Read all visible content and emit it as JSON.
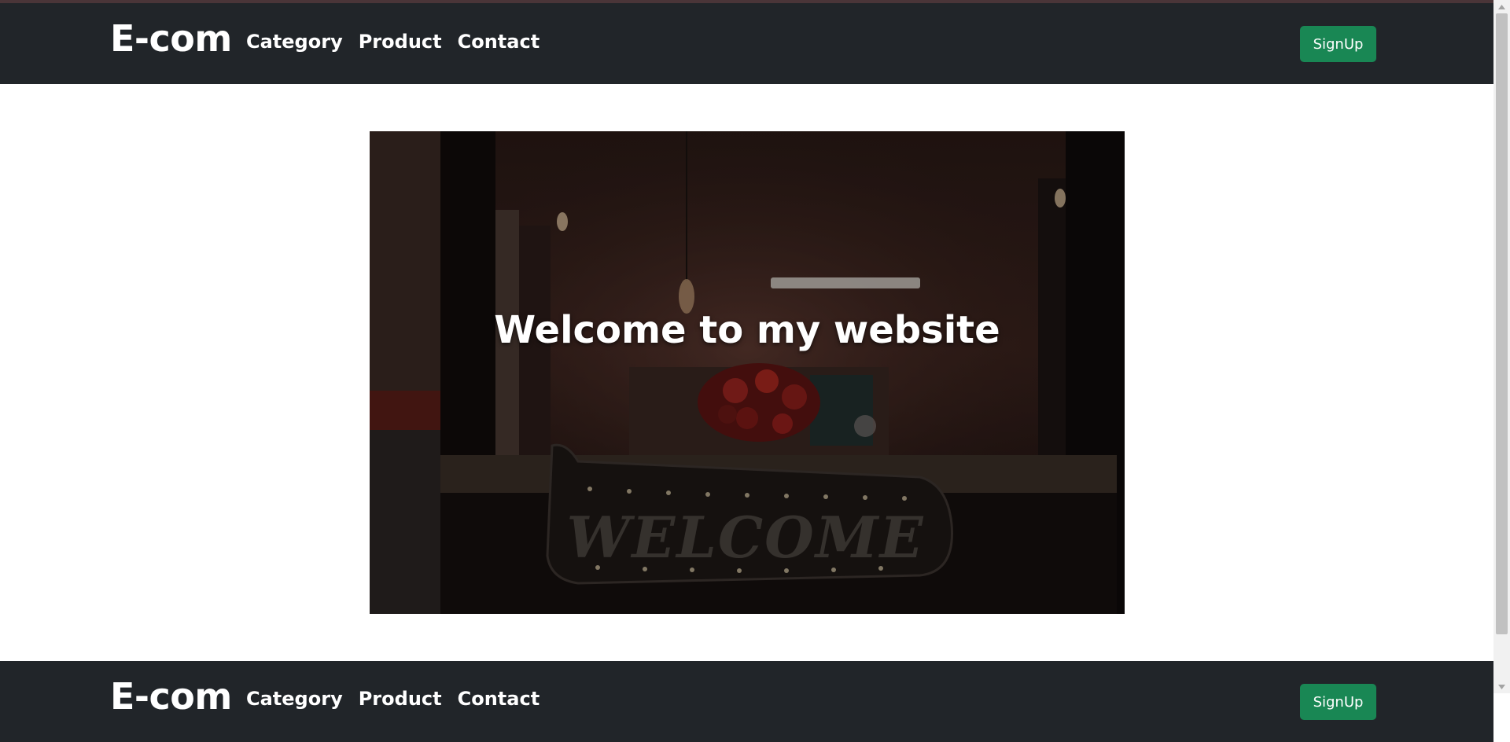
{
  "header": {
    "brand": "E-com",
    "nav": [
      "Category",
      "Product",
      "Contact"
    ],
    "signup_label": "SignUp"
  },
  "hero": {
    "heading": "Welcome to my website",
    "sign_text": "WELCOME"
  },
  "footer_nav": {
    "brand": "E-com",
    "nav": [
      "Category",
      "Product",
      "Contact"
    ],
    "signup_label": "SignUp"
  },
  "colors": {
    "navbar": "#212529",
    "signup_button": "#198754",
    "text": "#ffffff"
  },
  "icons": [
    "scroll-up-arrow-icon",
    "scroll-down-arrow-icon"
  ]
}
